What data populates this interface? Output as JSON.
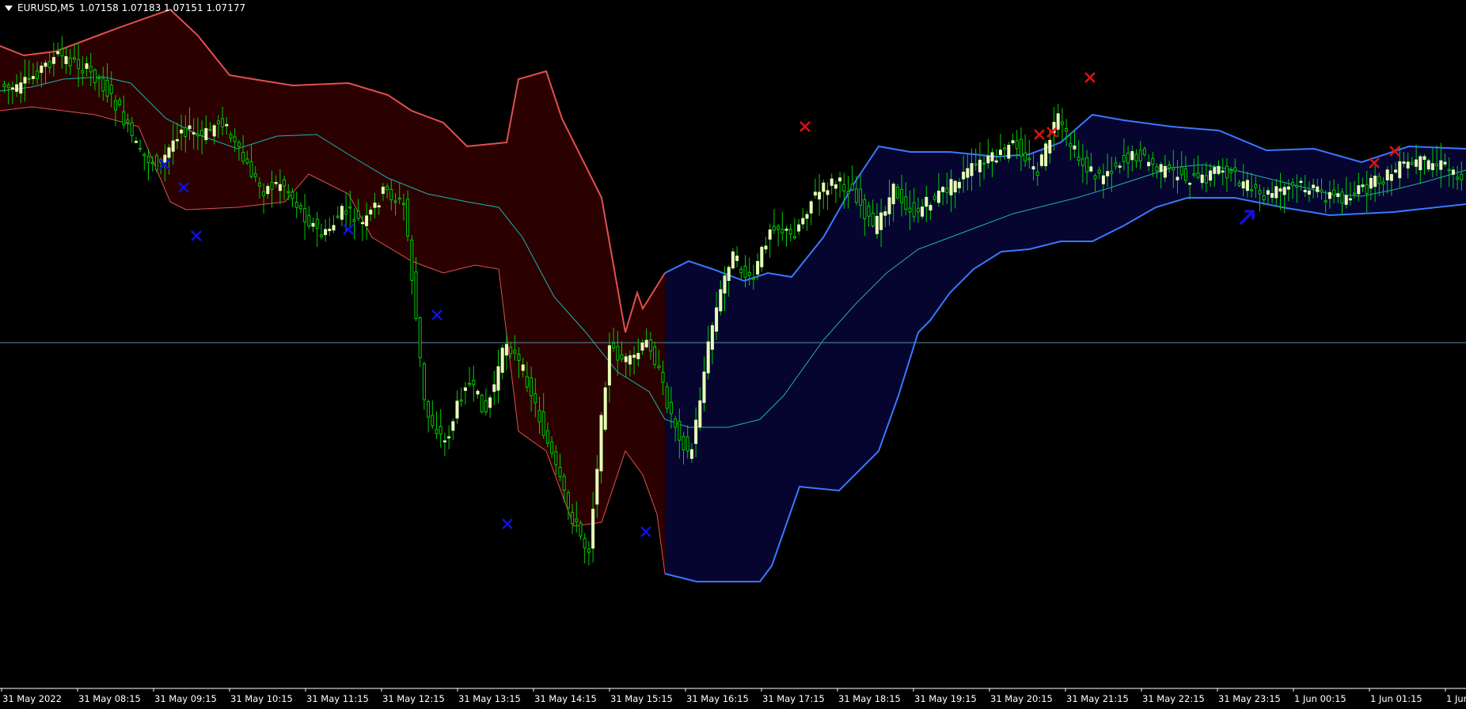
{
  "header": {
    "symbol": "EURUSD,M5",
    "quote": "1.07158 1.07183 1.07151 1.07177"
  },
  "colors": {
    "background": "#000000",
    "bull_body": "#e8ffb8",
    "wick": "#00cc00",
    "red_band_fill": "#2b0000",
    "red_band_line": "#e05050",
    "blue_band_fill": "#050530",
    "blue_band_line": "#3a78ff",
    "mid_line": "#20b0b0",
    "price_line": "#5a8aa8",
    "sell_marker": "#e01010",
    "buy_marker": "#1010e0"
  },
  "chart_data": {
    "type": "candlestick",
    "symbol": "EURUSD",
    "timeframe": "M5",
    "x_ticks": [
      "31 May 2022",
      "31 May 08:15",
      "31 May 09:15",
      "31 May 10:15",
      "31 May 11:15",
      "31 May 12:15",
      "31 May 13:15",
      "31 May 14:15",
      "31 May 15:15",
      "31 May 16:15",
      "31 May 17:15",
      "31 May 18:15",
      "31 May 19:15",
      "31 May 20:15",
      "31 May 21:15",
      "31 May 22:15",
      "31 May 23:15",
      "1 Jun 00:15",
      "1 Jun 01:15",
      "1 Jun"
    ],
    "price_line_index": 90,
    "price_path": [
      [
        0,
        105
      ],
      [
        5,
        115
      ],
      [
        10,
        90
      ],
      [
        15,
        70
      ],
      [
        20,
        82
      ],
      [
        25,
        100
      ],
      [
        30,
        140
      ],
      [
        35,
        195
      ],
      [
        40,
        210
      ],
      [
        45,
        160
      ],
      [
        50,
        175
      ],
      [
        55,
        150
      ],
      [
        60,
        200
      ],
      [
        65,
        240
      ],
      [
        70,
        230
      ],
      [
        75,
        270
      ],
      [
        80,
        300
      ],
      [
        85,
        265
      ],
      [
        90,
        285
      ],
      [
        95,
        240
      ],
      [
        100,
        260
      ],
      [
        105,
        520
      ],
      [
        110,
        560
      ],
      [
        115,
        480
      ],
      [
        120,
        520
      ],
      [
        125,
        430
      ],
      [
        130,
        480
      ],
      [
        135,
        560
      ],
      [
        140,
        640
      ],
      [
        145,
        700
      ],
      [
        150,
        440
      ],
      [
        155,
        460
      ],
      [
        160,
        430
      ],
      [
        165,
        520
      ],
      [
        170,
        580
      ],
      [
        175,
        420
      ],
      [
        180,
        320
      ],
      [
        185,
        360
      ],
      [
        190,
        280
      ],
      [
        195,
        300
      ],
      [
        200,
        250
      ],
      [
        205,
        230
      ],
      [
        210,
        240
      ],
      [
        215,
        290
      ],
      [
        220,
        240
      ],
      [
        225,
        270
      ],
      [
        230,
        250
      ],
      [
        235,
        230
      ],
      [
        240,
        210
      ],
      [
        245,
        200
      ],
      [
        250,
        180
      ],
      [
        255,
        220
      ],
      [
        260,
        150
      ],
      [
        265,
        200
      ],
      [
        270,
        225
      ],
      [
        275,
        205
      ],
      [
        280,
        195
      ],
      [
        285,
        215
      ],
      [
        290,
        220
      ],
      [
        295,
        230
      ],
      [
        300,
        210
      ],
      [
        305,
        230
      ],
      [
        310,
        250
      ],
      [
        315,
        240
      ],
      [
        320,
        235
      ],
      [
        325,
        245
      ],
      [
        330,
        250
      ],
      [
        335,
        240
      ],
      [
        340,
        225
      ],
      [
        345,
        210
      ],
      [
        350,
        205
      ],
      [
        355,
        210
      ],
      [
        360,
        225
      ]
    ],
    "bands": {
      "red": {
        "upper": [
          [
            0,
            58
          ],
          [
            30,
            70
          ],
          [
            70,
            65
          ],
          [
            150,
            35
          ],
          [
            215,
            12
          ],
          [
            250,
            45
          ],
          [
            290,
            95
          ],
          [
            320,
            100
          ],
          [
            370,
            108
          ],
          [
            440,
            105
          ],
          [
            490,
            120
          ],
          [
            520,
            140
          ],
          [
            560,
            155
          ],
          [
            590,
            185
          ],
          [
            640,
            180
          ],
          [
            655,
            100
          ],
          [
            690,
            90
          ],
          [
            710,
            150
          ],
          [
            760,
            250
          ],
          [
            790,
            420
          ],
          [
            805,
            370
          ],
          [
            812,
            390
          ],
          [
            840,
            345
          ]
        ],
        "lower": [
          [
            0,
            140
          ],
          [
            40,
            135
          ],
          [
            120,
            145
          ],
          [
            175,
            160
          ],
          [
            215,
            255
          ],
          [
            235,
            265
          ],
          [
            300,
            262
          ],
          [
            360,
            255
          ],
          [
            390,
            220
          ],
          [
            440,
            245
          ],
          [
            470,
            300
          ],
          [
            520,
            330
          ],
          [
            560,
            345
          ],
          [
            600,
            335
          ],
          [
            630,
            340
          ],
          [
            655,
            545
          ],
          [
            690,
            570
          ],
          [
            725,
            665
          ],
          [
            760,
            660
          ],
          [
            790,
            570
          ],
          [
            812,
            600
          ],
          [
            830,
            650
          ],
          [
            840,
            725
          ]
        ]
      },
      "blue": {
        "upper": [
          [
            840,
            345
          ],
          [
            870,
            330
          ],
          [
            900,
            340
          ],
          [
            940,
            355
          ],
          [
            970,
            345
          ],
          [
            1000,
            350
          ],
          [
            1040,
            300
          ],
          [
            1080,
            230
          ],
          [
            1110,
            185
          ],
          [
            1150,
            192
          ],
          [
            1200,
            192
          ],
          [
            1260,
            198
          ],
          [
            1300,
            195
          ],
          [
            1340,
            180
          ],
          [
            1380,
            145
          ],
          [
            1420,
            152
          ],
          [
            1480,
            160
          ],
          [
            1540,
            165
          ],
          [
            1600,
            190
          ],
          [
            1660,
            188
          ],
          [
            1720,
            205
          ],
          [
            1780,
            185
          ],
          [
            1852,
            188
          ]
        ],
        "lower": [
          [
            840,
            725
          ],
          [
            880,
            735
          ],
          [
            960,
            735
          ],
          [
            975,
            715
          ],
          [
            1010,
            615
          ],
          [
            1060,
            620
          ],
          [
            1090,
            590
          ],
          [
            1110,
            570
          ],
          [
            1135,
            500
          ],
          [
            1160,
            420
          ],
          [
            1175,
            405
          ],
          [
            1200,
            370
          ],
          [
            1230,
            340
          ],
          [
            1265,
            318
          ],
          [
            1300,
            315
          ],
          [
            1340,
            305
          ],
          [
            1380,
            305
          ],
          [
            1420,
            285
          ],
          [
            1460,
            262
          ],
          [
            1500,
            250
          ],
          [
            1560,
            250
          ],
          [
            1620,
            262
          ],
          [
            1680,
            272
          ],
          [
            1760,
            268
          ],
          [
            1852,
            258
          ]
        ]
      }
    },
    "mid_line": [
      [
        0,
        115
      ],
      [
        40,
        110
      ],
      [
        80,
        100
      ],
      [
        130,
        97
      ],
      [
        165,
        105
      ],
      [
        210,
        150
      ],
      [
        250,
        170
      ],
      [
        300,
        188
      ],
      [
        350,
        172
      ],
      [
        400,
        170
      ],
      [
        440,
        195
      ],
      [
        490,
        225
      ],
      [
        540,
        245
      ],
      [
        590,
        255
      ],
      [
        630,
        262
      ],
      [
        660,
        300
      ],
      [
        700,
        375
      ],
      [
        740,
        420
      ],
      [
        780,
        470
      ],
      [
        820,
        495
      ],
      [
        840,
        530
      ],
      [
        870,
        540
      ],
      [
        920,
        540
      ],
      [
        960,
        530
      ],
      [
        990,
        500
      ],
      [
        1040,
        430
      ],
      [
        1080,
        385
      ],
      [
        1120,
        345
      ],
      [
        1160,
        315
      ],
      [
        1200,
        300
      ],
      [
        1240,
        285
      ],
      [
        1280,
        270
      ],
      [
        1320,
        260
      ],
      [
        1360,
        250
      ],
      [
        1400,
        238
      ],
      [
        1440,
        225
      ],
      [
        1480,
        212
      ],
      [
        1520,
        208
      ],
      [
        1560,
        215
      ],
      [
        1600,
        225
      ],
      [
        1640,
        235
      ],
      [
        1680,
        245
      ],
      [
        1720,
        248
      ],
      [
        1760,
        240
      ],
      [
        1800,
        230
      ],
      [
        1852,
        215
      ]
    ],
    "markers": [
      {
        "kind": "buy",
        "x": 208,
        "y": 208
      },
      {
        "kind": "buy",
        "x": 232,
        "y": 237
      },
      {
        "kind": "buy",
        "x": 248,
        "y": 298
      },
      {
        "kind": "buy",
        "x": 440,
        "y": 290
      },
      {
        "kind": "buy",
        "x": 552,
        "y": 398
      },
      {
        "kind": "buy",
        "x": 641,
        "y": 662
      },
      {
        "kind": "buy",
        "x": 816,
        "y": 672
      },
      {
        "kind": "sell",
        "x": 1017,
        "y": 160
      },
      {
        "kind": "sell",
        "x": 1313,
        "y": 170
      },
      {
        "kind": "sell",
        "x": 1329,
        "y": 167
      },
      {
        "kind": "sell",
        "x": 1377,
        "y": 98
      },
      {
        "kind": "sell",
        "x": 1736,
        "y": 206
      },
      {
        "kind": "sell",
        "x": 1762,
        "y": 191
      },
      {
        "kind": "arrow",
        "x": 1576,
        "y": 274
      }
    ]
  }
}
